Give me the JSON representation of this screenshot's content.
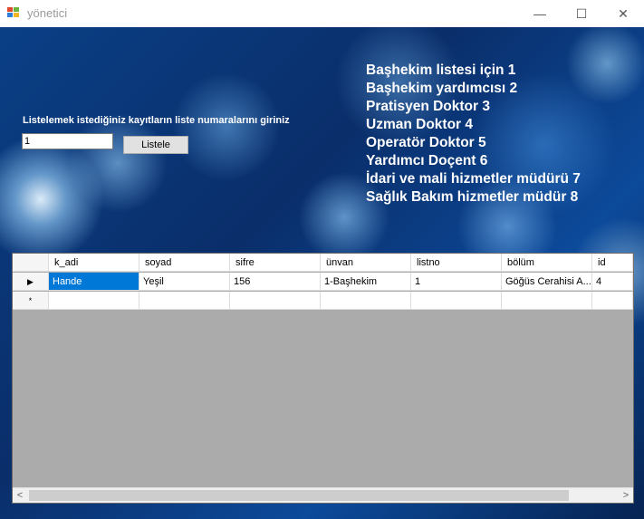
{
  "window": {
    "title": "yönetici",
    "minimize_glyph": "—",
    "maximize_glyph": "☐",
    "close_glyph": "✕"
  },
  "form": {
    "prompt": "Listelemek istediğiniz kayıtların liste numaralarını giriniz",
    "input_value": "1",
    "list_button": "Listele"
  },
  "legend": [
    "Başhekim listesi  için 1",
    "Başhekim yardımcısı 2",
    "Pratisyen Doktor 3",
    "Uzman Doktor 4",
    "Operatör Doktor 5",
    "Yardımcı Doçent 6",
    "İdari ve mali hizmetler müdürü 7",
    "Sağlık Bakım hizmetler müdür 8"
  ],
  "grid": {
    "columns": [
      "k_adi",
      "soyad",
      "sifre",
      "ünvan",
      "listno",
      "bölüm",
      "id"
    ],
    "rows": [
      [
        "Hande",
        "Yeşil",
        "156",
        "1-Başhekim",
        "1",
        "Göğüs Cerahisi A...",
        "4"
      ]
    ],
    "current_row_marker": "▶",
    "new_row_marker": "*",
    "scroll_left": "<",
    "scroll_right": ">"
  }
}
